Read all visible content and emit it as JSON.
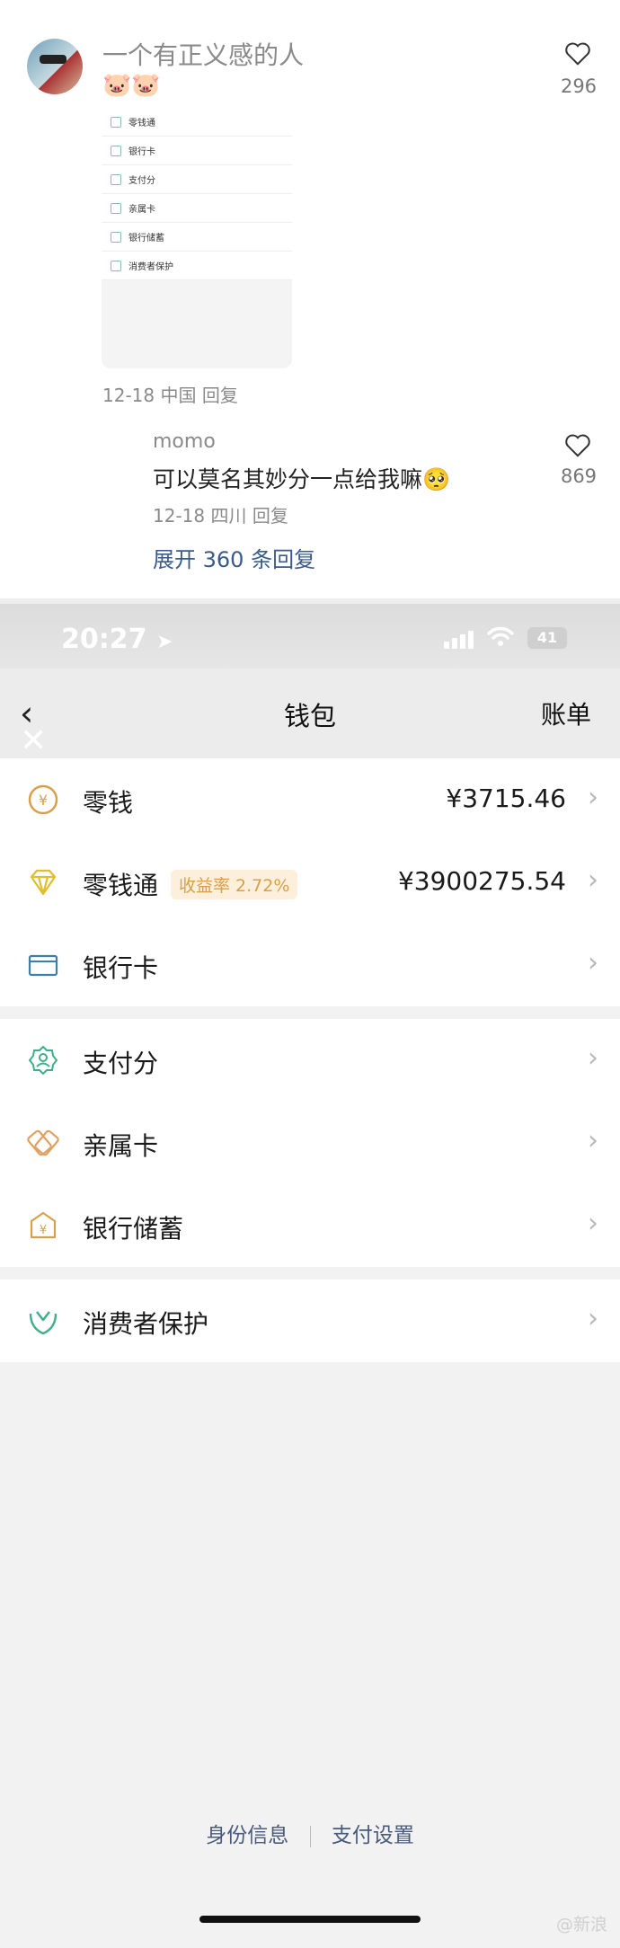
{
  "comment": {
    "username": "一个有正义感的人",
    "emoji": "🐷🐷",
    "likes": "296",
    "thumbnail_rows": [
      "零钱通",
      "银行卡",
      "支付分",
      "亲属卡",
      "银行储蓄",
      "消费者保护"
    ],
    "meta": "12-18 中国 回复"
  },
  "reply": {
    "username": "momo",
    "text": "可以莫名其妙分一点给我嘛🥺",
    "likes": "869",
    "meta": "12-18 四川 回复",
    "expand_label": "展开 360 条回复"
  },
  "status_bar": {
    "time": "20:27",
    "location_arrow": "➤",
    "battery": "41"
  },
  "wallet": {
    "nav": {
      "back": "‹",
      "close": "✕",
      "title": "钱包",
      "right": "账单"
    },
    "items": [
      {
        "label": "零钱",
        "value": "¥3715.46",
        "icon": "coin-icon"
      },
      {
        "label": "零钱通",
        "badge": "收益率 2.72%",
        "value": "¥3900275.54",
        "icon": "diamond-icon"
      },
      {
        "label": "银行卡",
        "icon": "card-icon"
      },
      {
        "label": "支付分",
        "icon": "score-icon"
      },
      {
        "label": "亲属卡",
        "icon": "family-card-icon"
      },
      {
        "label": "银行储蓄",
        "icon": "savings-icon"
      },
      {
        "label": "消费者保护",
        "icon": "protection-icon"
      }
    ],
    "chevron": "›",
    "footer_links": [
      "身份信息",
      "支付设置"
    ]
  },
  "watermark": "@新浪",
  "colors": {
    "accent_gold": "#d8a04a",
    "green": "#3fae8a",
    "blue": "#3d7fa8"
  }
}
